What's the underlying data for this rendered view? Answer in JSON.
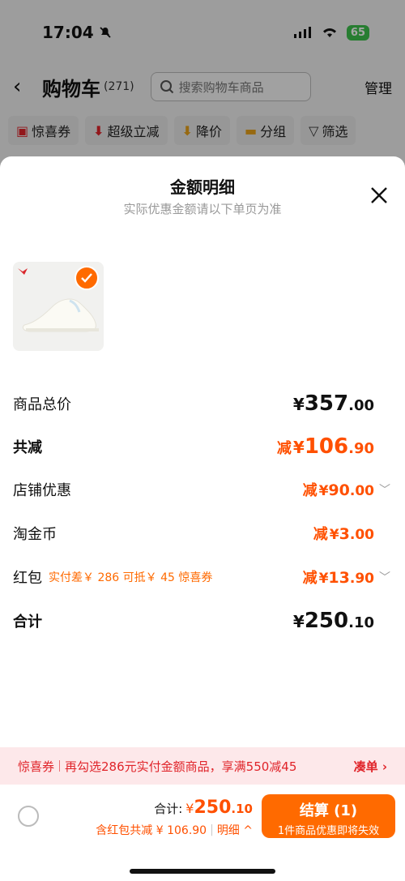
{
  "status": {
    "time": "17:04",
    "battery": "65"
  },
  "nav": {
    "back": "‹",
    "title": "购物车",
    "count": "(271)",
    "search_placeholder": "搜索购物车商品",
    "manage": "管理"
  },
  "chips": [
    {
      "icon": "coupon-icon",
      "label": "惊喜券"
    },
    {
      "icon": "down-arrow-icon",
      "label": "超级立减"
    },
    {
      "icon": "price-drop-icon",
      "label": "降价"
    },
    {
      "icon": "folder-icon",
      "label": "分组"
    },
    {
      "icon": "filter-icon",
      "label": "筛选"
    }
  ],
  "sheet": {
    "title": "金额明细",
    "subtitle": "实际优惠金额请以下单页为准",
    "rows": [
      {
        "label": "商品总价",
        "prefix": "",
        "currency": "¥",
        "int": "357",
        "dec": ".00"
      },
      {
        "label": "共减",
        "prefix": "减",
        "currency": "¥",
        "int": "106",
        "dec": ".90"
      },
      {
        "label": "店铺优惠",
        "prefix": "减",
        "currency": "¥",
        "int": "90",
        "dec": ".00"
      },
      {
        "label": "淘金币",
        "prefix": "减",
        "currency": "¥",
        "int": "3",
        "dec": ".00"
      },
      {
        "label": "红包",
        "note": "实付差￥ 286 可抵￥ 45 惊喜券",
        "prefix": "减",
        "currency": "¥",
        "int": "13",
        "dec": ".90"
      },
      {
        "label": "合计",
        "prefix": "",
        "currency": "¥",
        "int": "250",
        "dec": ".10"
      }
    ]
  },
  "banner": {
    "tag": "惊喜券",
    "text": "再勾选286元实付金额商品，享满550减45",
    "action": "凑单 ›"
  },
  "bottom": {
    "total_label": "合计:",
    "total_currency": "¥",
    "total_int": "250",
    "total_dec": ".10",
    "discount_text": "含红包共减 ¥ 106.90",
    "detail": "明细 ^",
    "pay_label": "结算 (1)",
    "pay_sub": "1件商品优惠即将失效"
  },
  "colors": {
    "accent": "#ff6a00",
    "price": "#ff5000",
    "banner_bg": "#fde8ea",
    "banner_text": "#e0242a"
  }
}
